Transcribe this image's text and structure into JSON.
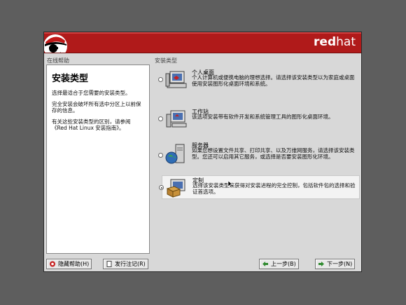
{
  "banner": {
    "brand_bold": "red",
    "brand_light": "hat"
  },
  "sections": {
    "help": "在线帮助",
    "install_type": "安装类型"
  },
  "help": {
    "title": "安装类型",
    "paragraphs": [
      "选择最适合于您需要的安装类型。",
      "完全安装会破坏所有选中分区上以前保存的信息。",
      "有关这些安装类型的区别，请参阅《Red Hat Linux 安装指南》。"
    ]
  },
  "options": [
    {
      "title": "个人桌面",
      "desc": "个人计算机或便携电脑的理想选择。请选择该安装类型以为家庭或桌面使用安装图形化桌面环境和系统。",
      "icon": "desktop-computer-icon",
      "selected": false
    },
    {
      "title": "工作站",
      "desc": "该选项安装带有软件开发和系统管理工具的图形化桌面环境。",
      "icon": "workstation-icon",
      "selected": false
    },
    {
      "title": "服务器",
      "desc": "如果您想设置文件共享、打印共享、以及万维网服务，请选择该安装类型。您还可以启用其它服务，或选择是否要安装图形化环境。",
      "icon": "server-globe-icon",
      "selected": false
    },
    {
      "title": "定制",
      "desc": "选择该安装类型来获得对安装进程的完全控制，包括软件包的选择和验证首选项。",
      "icon": "custom-package-icon",
      "selected": true
    }
  ],
  "buttons": {
    "hide_help": "隐藏帮助(H)",
    "release_notes": "发行注记(R)",
    "back": "上一步(B)",
    "next": "下一步(N)"
  },
  "colors": {
    "banner": "#b01a1a",
    "background": "#5e5e5e",
    "window": "#d8d8d8"
  }
}
